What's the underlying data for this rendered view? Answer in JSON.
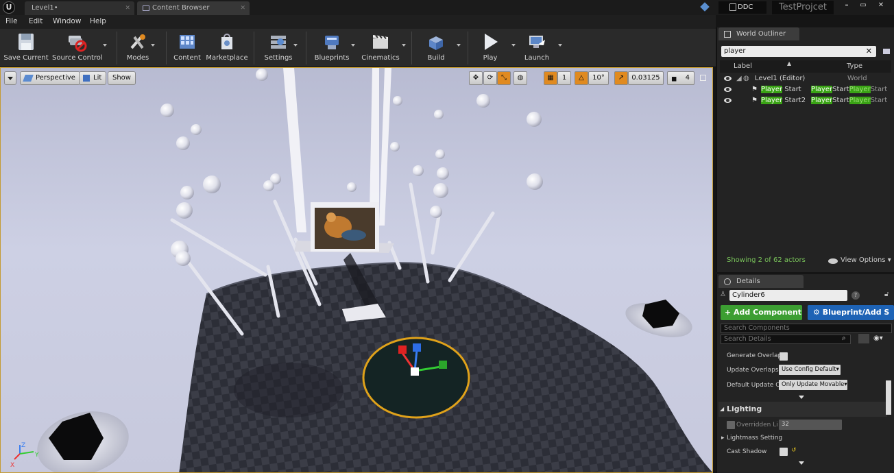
{
  "titlebar": {
    "logo": "U",
    "tabs": [
      {
        "label": "Level1•"
      },
      {
        "label": "Content Browser"
      }
    ],
    "ddc": "DDC",
    "project": "TestProjcet",
    "window_buttons": [
      "–",
      "▭",
      "✕"
    ]
  },
  "menu": [
    "File",
    "Edit",
    "Window",
    "Help"
  ],
  "toolbar": [
    {
      "label": "Save Current",
      "icon": "save-icon"
    },
    {
      "label": "Source Control",
      "icon": "source-control-icon"
    },
    {
      "label": "Modes",
      "icon": "modes-icon"
    },
    {
      "label": "Content",
      "icon": "content-icon"
    },
    {
      "label": "Marketplace",
      "icon": "marketplace-icon"
    },
    {
      "label": "Settings",
      "icon": "settings-icon"
    },
    {
      "label": "Blueprints",
      "icon": "blueprints-icon"
    },
    {
      "label": "Cinematics",
      "icon": "cinematics-icon"
    },
    {
      "label": "Build",
      "icon": "build-icon"
    },
    {
      "label": "Play",
      "icon": "play-icon"
    },
    {
      "label": "Launch",
      "icon": "launch-icon"
    }
  ],
  "viewport": {
    "perspective": "Perspective",
    "lit": "Lit",
    "show": "Show",
    "grid_snap": "1",
    "rotation_snap": "10°",
    "scale_snap": "0.03125",
    "camera_speed": "4",
    "axis_labels": {
      "x": "X",
      "y": "Y",
      "z": "Z"
    }
  },
  "outliner": {
    "tab": "World Outliner",
    "search": "player",
    "col_label": "Label",
    "col_type": "Type",
    "rows": [
      {
        "label": "Level1 (Editor)",
        "type": "World"
      },
      {
        "label_hl": "Player",
        "label_rest": " Start",
        "type_hl": "Player",
        "type_rest": "Start",
        "type_hl2": "Player",
        "type_rest2": "Start"
      },
      {
        "label_hl": "Player",
        "label_rest": " Start2",
        "type_hl": "Player",
        "type_rest": "Start",
        "type_hl2": "Player",
        "type_rest2": "Start"
      }
    ],
    "status": "Showing 2 of 62 actors",
    "view_options": "View Options"
  },
  "details": {
    "tab": "Details",
    "name": "Cylinder6",
    "add_component": "+ Add Component",
    "blueprint_add": "Blueprint/Add S",
    "search_components": "Search Components",
    "search_details": "Search Details",
    "props": {
      "generate_overlap": "Generate Overlap",
      "update_overlaps": "Update Overlaps M",
      "update_overlaps_value": "Use Config Default",
      "default_update": "Default Update Ov",
      "default_update_value": "Only Update Movable",
      "lighting": "Lighting",
      "overridden": "Overridden Li",
      "overridden_value": "32",
      "lightmass": "Lightmass Setting",
      "cast_shadow": "Cast Shadow"
    }
  },
  "colors": {
    "accent_orange": "#c49a30",
    "green": "#3c9e32",
    "blue": "#1e63b5",
    "highlight": "#3aa315"
  }
}
